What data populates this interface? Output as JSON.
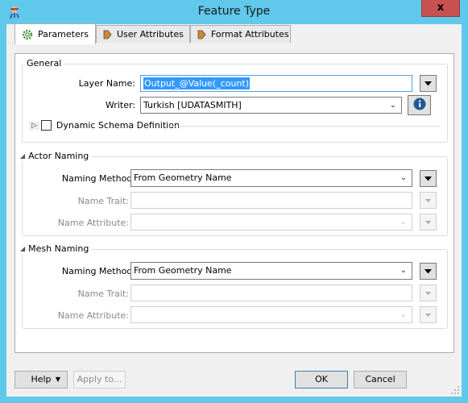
{
  "window": {
    "title": "Feature Type",
    "close_label": "x"
  },
  "tabs": [
    {
      "label": "Parameters",
      "icon": "gear-icon",
      "active": true
    },
    {
      "label": "User Attributes",
      "icon": "arrow-tag-icon",
      "active": false
    },
    {
      "label": "Format Attributes",
      "icon": "arrow-tag-icon",
      "active": false
    }
  ],
  "general": {
    "title": "General",
    "layer_name_label": "Layer Name:",
    "layer_name_value": "Output_@Value(_count)",
    "writer_label": "Writer:",
    "writer_value": "Turkish [UDATASMITH]",
    "dynamic_schema_label": "Dynamic Schema Definition",
    "dynamic_schema_checked": false
  },
  "actor_naming": {
    "title": "Actor Naming",
    "naming_method_label": "Naming Method:",
    "naming_method_value": "From Geometry Name",
    "name_trait_label": "Name Trait:",
    "name_trait_value": "",
    "name_attribute_label": "Name Attribute:",
    "name_attribute_value": ""
  },
  "mesh_naming": {
    "title": "Mesh Naming",
    "naming_method_label": "Naming Method:",
    "naming_method_value": "From Geometry Name",
    "name_trait_label": "Name Trait:",
    "name_trait_value": "",
    "name_attribute_label": "Name Attribute:",
    "name_attribute_value": ""
  },
  "footer": {
    "help_label": "Help",
    "apply_label": "Apply to...",
    "ok_label": "OK",
    "cancel_label": "Cancel"
  },
  "colors": {
    "titlebar": "#60c8ea",
    "close": "#c75050",
    "selection": "#3399ff",
    "focus": "#569de5",
    "info_icon": "#1e5a96",
    "gear_icon": "#3a8a2e",
    "tag_icon": "#c8873a"
  }
}
